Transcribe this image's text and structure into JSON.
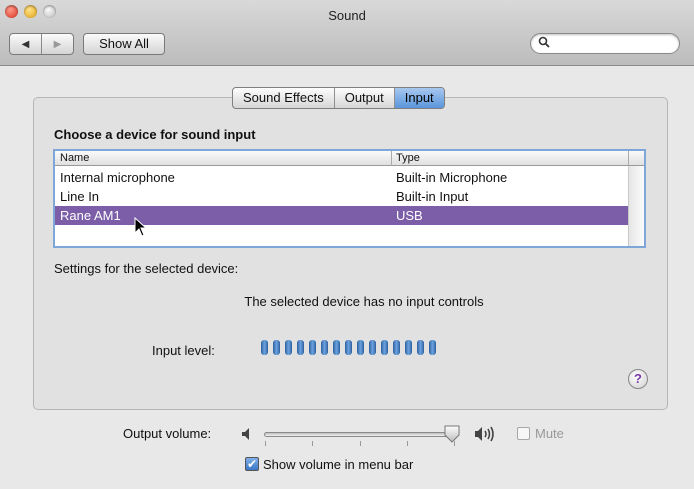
{
  "window": {
    "title": "Sound"
  },
  "toolbar": {
    "back_icon": "back-arrow-icon",
    "forward_icon": "forward-arrow-icon",
    "show_all_label": "Show All",
    "search_placeholder": "",
    "search_icon": "search-icon"
  },
  "tabs": [
    {
      "label": "Sound Effects",
      "active": false
    },
    {
      "label": "Output",
      "active": false
    },
    {
      "label": "Input",
      "active": true
    }
  ],
  "input": {
    "heading": "Choose a device for sound input",
    "columns": [
      "Name",
      "Type"
    ],
    "devices": [
      {
        "name": "Internal microphone",
        "type": "Built-in Microphone",
        "selected": false
      },
      {
        "name": "Line In",
        "type": "Built-in Input",
        "selected": false
      },
      {
        "name": "Rane AM1",
        "type": "USB",
        "selected": true
      }
    ],
    "settings_label": "Settings for the selected device:",
    "no_controls_text": "The selected device has no input controls",
    "level_label": "Input level:",
    "level_segments": 15,
    "help_label": "?"
  },
  "bottom": {
    "output_volume_label": "Output volume:",
    "output_volume_fraction": 0.93,
    "mute_label": "Mute",
    "mute_checked": false,
    "show_volume_label": "Show volume in menu bar",
    "show_volume_checked": true
  },
  "colors": {
    "selection": "#7b5ea7",
    "active_tab": "#5a95dc",
    "level_meter": "#2a5f9e"
  }
}
